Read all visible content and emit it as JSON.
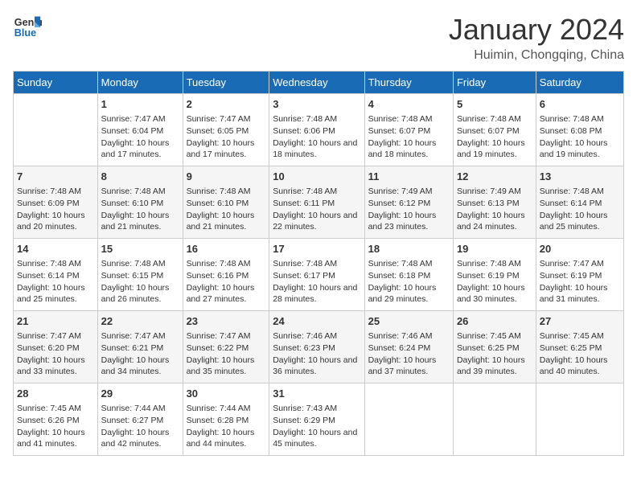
{
  "header": {
    "logo_line1": "General",
    "logo_line2": "Blue",
    "month": "January 2024",
    "location": "Huimin, Chongqing, China"
  },
  "weekdays": [
    "Sunday",
    "Monday",
    "Tuesday",
    "Wednesday",
    "Thursday",
    "Friday",
    "Saturday"
  ],
  "weeks": [
    [
      {
        "day": "",
        "info": ""
      },
      {
        "day": "1",
        "info": "Sunrise: 7:47 AM\nSunset: 6:04 PM\nDaylight: 10 hours and 17 minutes."
      },
      {
        "day": "2",
        "info": "Sunrise: 7:47 AM\nSunset: 6:05 PM\nDaylight: 10 hours and 17 minutes."
      },
      {
        "day": "3",
        "info": "Sunrise: 7:48 AM\nSunset: 6:06 PM\nDaylight: 10 hours and 18 minutes."
      },
      {
        "day": "4",
        "info": "Sunrise: 7:48 AM\nSunset: 6:07 PM\nDaylight: 10 hours and 18 minutes."
      },
      {
        "day": "5",
        "info": "Sunrise: 7:48 AM\nSunset: 6:07 PM\nDaylight: 10 hours and 19 minutes."
      },
      {
        "day": "6",
        "info": "Sunrise: 7:48 AM\nSunset: 6:08 PM\nDaylight: 10 hours and 19 minutes."
      }
    ],
    [
      {
        "day": "7",
        "info": "Sunrise: 7:48 AM\nSunset: 6:09 PM\nDaylight: 10 hours and 20 minutes."
      },
      {
        "day": "8",
        "info": "Sunrise: 7:48 AM\nSunset: 6:10 PM\nDaylight: 10 hours and 21 minutes."
      },
      {
        "day": "9",
        "info": "Sunrise: 7:48 AM\nSunset: 6:10 PM\nDaylight: 10 hours and 21 minutes."
      },
      {
        "day": "10",
        "info": "Sunrise: 7:48 AM\nSunset: 6:11 PM\nDaylight: 10 hours and 22 minutes."
      },
      {
        "day": "11",
        "info": "Sunrise: 7:49 AM\nSunset: 6:12 PM\nDaylight: 10 hours and 23 minutes."
      },
      {
        "day": "12",
        "info": "Sunrise: 7:49 AM\nSunset: 6:13 PM\nDaylight: 10 hours and 24 minutes."
      },
      {
        "day": "13",
        "info": "Sunrise: 7:48 AM\nSunset: 6:14 PM\nDaylight: 10 hours and 25 minutes."
      }
    ],
    [
      {
        "day": "14",
        "info": "Sunrise: 7:48 AM\nSunset: 6:14 PM\nDaylight: 10 hours and 25 minutes."
      },
      {
        "day": "15",
        "info": "Sunrise: 7:48 AM\nSunset: 6:15 PM\nDaylight: 10 hours and 26 minutes."
      },
      {
        "day": "16",
        "info": "Sunrise: 7:48 AM\nSunset: 6:16 PM\nDaylight: 10 hours and 27 minutes."
      },
      {
        "day": "17",
        "info": "Sunrise: 7:48 AM\nSunset: 6:17 PM\nDaylight: 10 hours and 28 minutes."
      },
      {
        "day": "18",
        "info": "Sunrise: 7:48 AM\nSunset: 6:18 PM\nDaylight: 10 hours and 29 minutes."
      },
      {
        "day": "19",
        "info": "Sunrise: 7:48 AM\nSunset: 6:19 PM\nDaylight: 10 hours and 30 minutes."
      },
      {
        "day": "20",
        "info": "Sunrise: 7:47 AM\nSunset: 6:19 PM\nDaylight: 10 hours and 31 minutes."
      }
    ],
    [
      {
        "day": "21",
        "info": "Sunrise: 7:47 AM\nSunset: 6:20 PM\nDaylight: 10 hours and 33 minutes."
      },
      {
        "day": "22",
        "info": "Sunrise: 7:47 AM\nSunset: 6:21 PM\nDaylight: 10 hours and 34 minutes."
      },
      {
        "day": "23",
        "info": "Sunrise: 7:47 AM\nSunset: 6:22 PM\nDaylight: 10 hours and 35 minutes."
      },
      {
        "day": "24",
        "info": "Sunrise: 7:46 AM\nSunset: 6:23 PM\nDaylight: 10 hours and 36 minutes."
      },
      {
        "day": "25",
        "info": "Sunrise: 7:46 AM\nSunset: 6:24 PM\nDaylight: 10 hours and 37 minutes."
      },
      {
        "day": "26",
        "info": "Sunrise: 7:45 AM\nSunset: 6:25 PM\nDaylight: 10 hours and 39 minutes."
      },
      {
        "day": "27",
        "info": "Sunrise: 7:45 AM\nSunset: 6:25 PM\nDaylight: 10 hours and 40 minutes."
      }
    ],
    [
      {
        "day": "28",
        "info": "Sunrise: 7:45 AM\nSunset: 6:26 PM\nDaylight: 10 hours and 41 minutes."
      },
      {
        "day": "29",
        "info": "Sunrise: 7:44 AM\nSunset: 6:27 PM\nDaylight: 10 hours and 42 minutes."
      },
      {
        "day": "30",
        "info": "Sunrise: 7:44 AM\nSunset: 6:28 PM\nDaylight: 10 hours and 44 minutes."
      },
      {
        "day": "31",
        "info": "Sunrise: 7:43 AM\nSunset: 6:29 PM\nDaylight: 10 hours and 45 minutes."
      },
      {
        "day": "",
        "info": ""
      },
      {
        "day": "",
        "info": ""
      },
      {
        "day": "",
        "info": ""
      }
    ]
  ]
}
